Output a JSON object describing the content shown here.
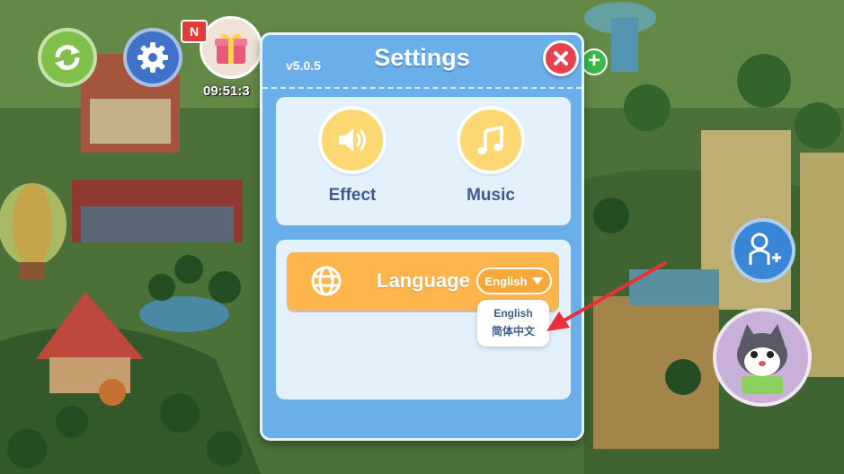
{
  "hud": {
    "new_badge": "N",
    "timer": "09:51:3",
    "plus": "+"
  },
  "dialog": {
    "version": "v5.0.5",
    "title": "Settings",
    "sound": {
      "effect_label": "Effect",
      "music_label": "Music"
    },
    "language": {
      "label": "Language",
      "selected": "English",
      "options": [
        "English",
        "简体中文"
      ]
    }
  },
  "colors": {
    "dialog_bg": "#6aaeea",
    "panel_bg": "#e3f1fc",
    "language_row": "#fdb54c",
    "sound_circle": "#fcd772",
    "close_button": "#e8414f",
    "label_text": "#3e5b8c",
    "arrow": "#e8303a"
  }
}
